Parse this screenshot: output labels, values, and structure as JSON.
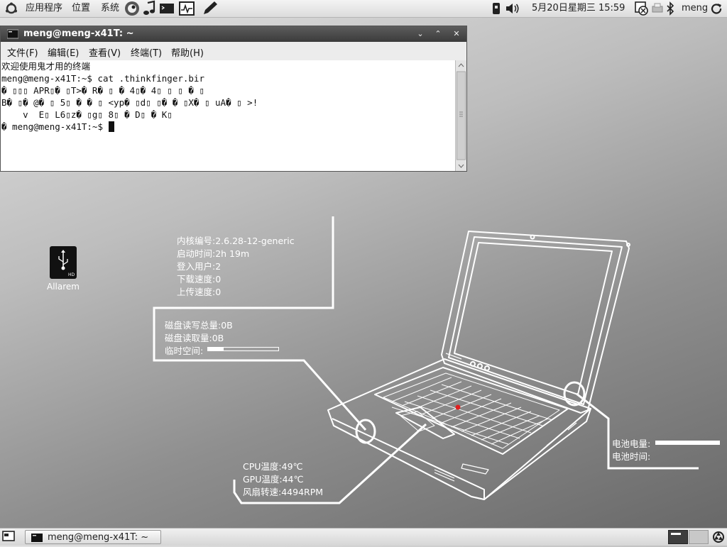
{
  "top_panel": {
    "menus": [
      "应用程序",
      "位置",
      "系统"
    ],
    "clock": "5月20日星期三 15:59",
    "user": "meng"
  },
  "terminal": {
    "title": "meng@meng-x41T: ~",
    "menu": [
      "文件(F)",
      "编辑(E)",
      "查看(V)",
      "终端(T)",
      "帮助(H)"
    ],
    "lines": [
      "欢迎使用鬼才用的终端",
      "meng@meng-x41T:~$ cat .thinkfinger.bir",
      "� ▯▯▯ APR▯� ▯T>� R� ▯ � 4▯� 4▯ ▯ ▯ � ▯",
      "B� ▯� @� ▯ 5▯ � � ▯ <yp� ▯d▯ ▯� � ▯X� ▯ uA� ▯ >!",
      "    v  E▯ L6▯z� ▯g▯ 8▯ � D▯ � K▯",
      "� meng@meng-x41T:~$ "
    ]
  },
  "desktop": {
    "icon_label": "Allarem"
  },
  "conky": {
    "system": [
      "内核编号:2.6.28-12-generic",
      "启动时间:2h 19m",
      "登入用户:2",
      "下载速度:0",
      "上传速度:0"
    ],
    "disk": [
      "磁盘读写总量:0B",
      "磁盘读取量:0B",
      "临时空间:"
    ],
    "temp_usage": 0.22,
    "battery": [
      "电池电量:",
      "电池时间:"
    ],
    "battery_level": 1.0,
    "sensors": [
      "CPU温度:49℃",
      "GPU温度:44℃",
      "风扇转速:4494RPM"
    ]
  },
  "bottom_panel": {
    "task": "meng@meng-x41T: ~"
  }
}
